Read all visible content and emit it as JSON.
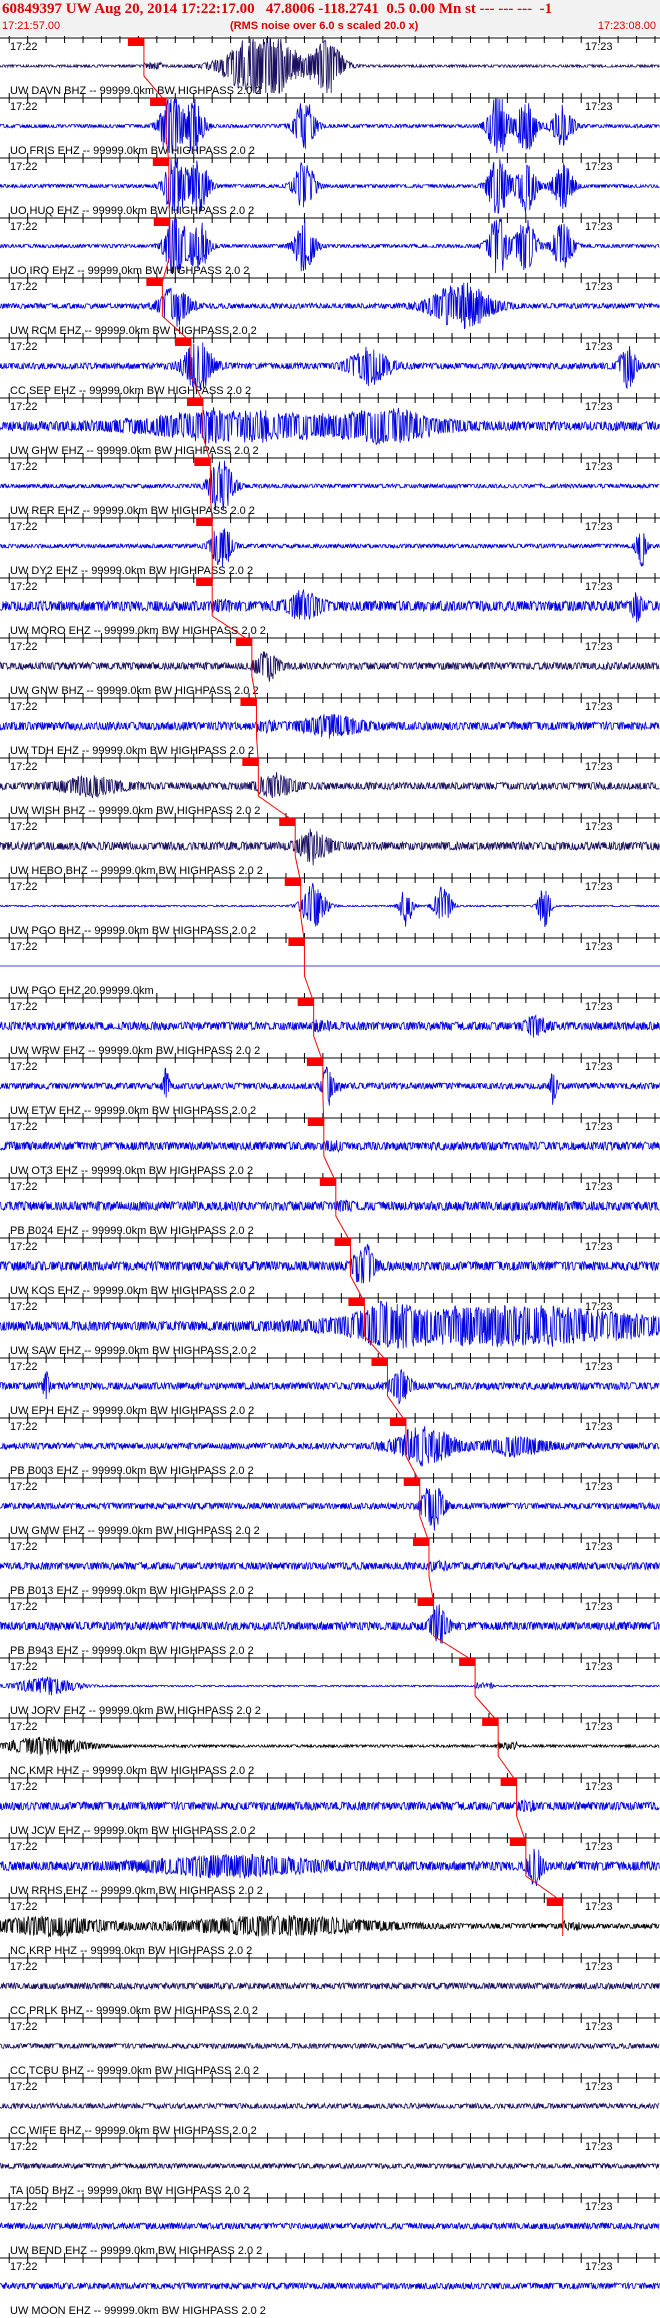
{
  "header": {
    "title": "60849397 UW Aug 20, 2014 17:22:17.00   47.8006 -118.2741  0.5 0.00 Mn st --- --- ---  -1",
    "start_time": "17:21:57.00",
    "noise_note": "(RMS noise over 6.0 s scaled 20.0 x)",
    "end_time": "17:23:08.00"
  },
  "colors": {
    "trace": "#0000e0",
    "trace_dark": "#1a1060",
    "trace_black": "#000000",
    "pick": "#ff0000",
    "header_text": "#e00000",
    "grid": "#000000"
  },
  "chart_data": {
    "type": "seismogram",
    "time_range": [
      "17:21:57.00",
      "17:23:08.00"
    ],
    "time_labels": [
      "17:22",
      "17:23"
    ],
    "traces": [
      {
        "label": "UW DAVN BHZ -- 99999.0km BW  HIGHPASS  2.0  2",
        "color": "dark",
        "pick": 15.6,
        "bursts": [
          [
            28.5,
            3.5,
            8
          ],
          [
            35.5,
            1.5,
            6
          ]
        ],
        "noise": 0.25
      },
      {
        "label": "UO FRIS EHZ -- 99999.0km BW  HIGHPASS  2.0  2",
        "color": "blue",
        "pick": 18.0,
        "bursts": [
          [
            18.5,
            1,
            8
          ],
          [
            21,
            1,
            6
          ],
          [
            33,
            1,
            6
          ],
          [
            54,
            1,
            7
          ],
          [
            57,
            1,
            6
          ],
          [
            61,
            1,
            5
          ]
        ],
        "noise": 0.35
      },
      {
        "label": "UO HUQ EHZ -- 99999.0km BW  HIGHPASS  2.0  2",
        "color": "blue",
        "pick": 18.3,
        "bursts": [
          [
            19,
            1,
            8
          ],
          [
            21.5,
            1,
            6
          ],
          [
            33,
            1,
            6
          ],
          [
            54,
            1,
            7
          ],
          [
            57,
            1,
            6
          ],
          [
            61,
            1,
            5
          ]
        ],
        "noise": 0.35
      },
      {
        "label": "UO IRO EHZ -- 99999.0km BW  HIGHPASS  2.0  2",
        "color": "blue",
        "pick": 18.4,
        "bursts": [
          [
            19,
            1,
            8
          ],
          [
            21.5,
            1,
            6
          ],
          [
            33,
            1,
            6
          ],
          [
            54,
            1,
            7
          ],
          [
            57,
            1,
            6
          ],
          [
            61,
            1,
            5
          ]
        ],
        "noise": 0.35
      },
      {
        "label": "UW RCM EHZ -- 99999.0km BW  HIGHPASS  2.0  2",
        "color": "blue",
        "pick": 17.6,
        "bursts": [
          [
            19,
            1.5,
            4
          ],
          [
            50,
            3,
            5
          ]
        ],
        "noise": 0.5
      },
      {
        "label": "CC SEP EHZ -- 99999.0km BW  HIGHPASS  2.0  2",
        "color": "blue",
        "pick": 20.7,
        "bursts": [
          [
            21.5,
            1.5,
            5
          ],
          [
            40,
            2,
            4
          ],
          [
            68,
            0.8,
            5
          ]
        ],
        "noise": 0.6
      },
      {
        "label": "UW GHW EHZ -- 99999.0km BW  HIGHPASS  2.0  2",
        "color": "blue",
        "pick": 22.0,
        "bursts": [
          [
            26,
            10,
            3
          ],
          [
            42,
            5,
            3
          ]
        ],
        "noise": 0.9
      },
      {
        "label": "UW RER EHZ -- 99999.0km BW  HIGHPASS  2.0  2",
        "color": "blue",
        "pick": 22.8,
        "bursts": [
          [
            24,
            1.2,
            6
          ]
        ],
        "noise": 0.4
      },
      {
        "label": "UW DY2 EHZ -- 99999.0km BW  HIGHPASS  2.0  2",
        "color": "blue",
        "pick": 23.0,
        "bursts": [
          [
            24,
            1,
            5
          ],
          [
            69.5,
            0.5,
            5
          ]
        ],
        "noise": 0.4
      },
      {
        "label": "UW MORO EHZ -- 99999.0km BW  HIGHPASS  2.0  2",
        "color": "blue",
        "pick": 23.0,
        "bursts": [
          [
            33,
            1.5,
            3
          ],
          [
            69,
            0.5,
            3
          ]
        ],
        "noise": 1.0
      },
      {
        "label": "UW GNW BHZ -- 99999.0km BW  HIGHPASS  2.0  2",
        "color": "dark",
        "pick": 27.3,
        "bursts": [
          [
            29,
            1,
            3
          ]
        ],
        "noise": 0.7
      },
      {
        "label": "UW TDH EHZ -- 99999.0km BW  HIGHPASS  2.0  2",
        "color": "blue",
        "pick": 27.8,
        "bursts": [
          [
            36,
            3,
            2
          ]
        ],
        "noise": 0.8
      },
      {
        "label": "UW WISH BHZ -- 99999.0km BW  HIGHPASS  2.0  2",
        "color": "dark",
        "pick": 28.0,
        "bursts": [
          [
            10,
            3,
            2
          ],
          [
            30,
            2,
            2
          ]
        ],
        "noise": 0.7
      },
      {
        "label": "UW HEBO BHZ -- 99999.0km BW  HIGHPASS  2.0  2",
        "color": "dark",
        "pick": 32.0,
        "bursts": [
          [
            34,
            1.5,
            3
          ]
        ],
        "noise": 0.8
      },
      {
        "label": "UW PGO BHZ -- 99999.0km BW  HIGHPASS  2.0  2",
        "color": "blue",
        "pick": 32.6,
        "bursts": [
          [
            34,
            1.2,
            5
          ],
          [
            44,
            0.6,
            5
          ],
          [
            48,
            0.8,
            5
          ],
          [
            59,
            0.6,
            5
          ]
        ],
        "noise": 0.15
      },
      {
        "label": "UW PGO EHZ 20.99999.0km",
        "color": "blue",
        "pick": 33.0,
        "bursts": [],
        "noise": 0.0
      },
      {
        "label": "UW WRW EHZ -- 99999.0km BW  HIGHPASS  2.0  2",
        "color": "blue",
        "pick": 34.0,
        "bursts": [
          [
            58,
            1,
            2
          ]
        ],
        "noise": 0.8
      },
      {
        "label": "UW ETW EHZ -- 99999.0km BW  HIGHPASS  2.0  2",
        "color": "blue",
        "pick": 35.0,
        "bursts": [
          [
            18,
            0.3,
            4
          ],
          [
            35.5,
            0.5,
            4
          ],
          [
            60,
            0.3,
            4
          ]
        ],
        "noise": 0.6
      },
      {
        "label": "UW OT3 EHZ -- 99999.0km BW  HIGHPASS  2.0  2",
        "color": "blue",
        "pick": 35.1,
        "bursts": [],
        "noise": 0.8
      },
      {
        "label": "PB B024 EHZ -- 99999.0km BW  HIGHPASS  2.0  2",
        "color": "blue",
        "pick": 36.4,
        "bursts": [],
        "noise": 0.9
      },
      {
        "label": "UW KOS EHZ -- 99999.0km BW  HIGHPASS  2.0  2",
        "color": "blue",
        "pick": 38.0,
        "bursts": [
          [
            39.5,
            1,
            4
          ]
        ],
        "noise": 0.9
      },
      {
        "label": "UW SAW EHZ -- 99999.0km BW  HIGHPASS  2.0  2",
        "color": "blue",
        "pick": 39.5,
        "bursts": [
          [
            42,
            3,
            3
          ],
          [
            55,
            15,
            4
          ]
        ],
        "noise": 0.9
      },
      {
        "label": "UW EPH EHZ -- 99999.0km BW  HIGHPASS  2.0  2",
        "color": "blue",
        "pick": 42.0,
        "bursts": [
          [
            43.5,
            1,
            3
          ],
          [
            5,
            0.3,
            3
          ]
        ],
        "noise": 0.7
      },
      {
        "label": "PB B003 EHZ -- 99999.0km BW  HIGHPASS  2.0  2",
        "color": "blue",
        "pick": 44.0,
        "bursts": [
          [
            46,
            3,
            4
          ],
          [
            56,
            3,
            2
          ]
        ],
        "noise": 0.6
      },
      {
        "label": "UW GMW EHZ -- 99999.0km BW  HIGHPASS  2.0  2",
        "color": "blue",
        "pick": 45.5,
        "bursts": [
          [
            47,
            1,
            5
          ]
        ],
        "noise": 0.6
      },
      {
        "label": "PB B013 EHZ -- 99999.0km BW  HIGHPASS  2.0  2",
        "color": "blue",
        "pick": 46.5,
        "bursts": [],
        "noise": 0.7
      },
      {
        "label": "PB B943 EHZ -- 99999.0km BW  HIGHPASS  2.0  2",
        "color": "blue",
        "pick": 47.0,
        "bursts": [
          [
            47.5,
            0.8,
            4
          ]
        ],
        "noise": 0.8
      },
      {
        "label": "UW JORV EHZ -- 99999.0km BW  HIGHPASS  2.0  2",
        "color": "blue",
        "pick": 51.5,
        "bursts": [
          [
            5,
            3,
            2
          ]
        ],
        "noise": 0.15
      },
      {
        "label": "NC KMR HHZ -- 99999.0km BW  HIGHPASS  2.0  2",
        "color": "black",
        "pick": 54.0,
        "bursts": [
          [
            5,
            4,
            2
          ]
        ],
        "noise": 0.25
      },
      {
        "label": "UW JCW EHZ -- 99999.0km BW  HIGHPASS  2.0  2",
        "color": "blue",
        "pick": 56.0,
        "bursts": [],
        "noise": 0.8
      },
      {
        "label": "UW RRHS EHZ -- 99999.0km BW  HIGHPASS  2.0  2",
        "color": "blue",
        "pick": 57.0,
        "bursts": [
          [
            25,
            8,
            2
          ],
          [
            58,
            0.6,
            4
          ]
        ],
        "noise": 0.9
      },
      {
        "label": "NC KRP HHZ -- 99999.0km BW  HIGHPASS  2.0  2",
        "color": "black",
        "pick": 61.0,
        "bursts": [
          [
            5,
            6,
            2
          ],
          [
            30,
            10,
            2
          ]
        ],
        "noise": 0.5
      },
      {
        "label": "CC PRLK BHZ -- 99999.0km BW  HIGHPASS  2.0  2",
        "color": "dark",
        "pick": null,
        "bursts": [],
        "noise": 0.6
      },
      {
        "label": "CC TCBU BHZ -- 99999.0km BW  HIGHPASS  2.0  2",
        "color": "dark",
        "pick": null,
        "bursts": [],
        "noise": 0.5
      },
      {
        "label": "CC WIFE BHZ -- 99999.0km BW  HIGHPASS  2.0  2",
        "color": "dark",
        "pick": null,
        "bursts": [],
        "noise": 0.5
      },
      {
        "label": "TA I05D BHZ -- 99999.0km BW  HIGHPASS  2.0  2",
        "color": "dark",
        "pick": null,
        "bursts": [],
        "noise": 0.5
      },
      {
        "label": "UW BEND EHZ -- 99999.0km BW  HIGHPASS  2.0  2",
        "color": "blue",
        "pick": null,
        "bursts": [],
        "noise": 0.6
      },
      {
        "label": "UW MOON EHZ -- 99999.0km BW  HIGHPASS  2.0  2",
        "color": "blue",
        "pick": null,
        "bursts": [],
        "noise": 0.6
      }
    ]
  }
}
